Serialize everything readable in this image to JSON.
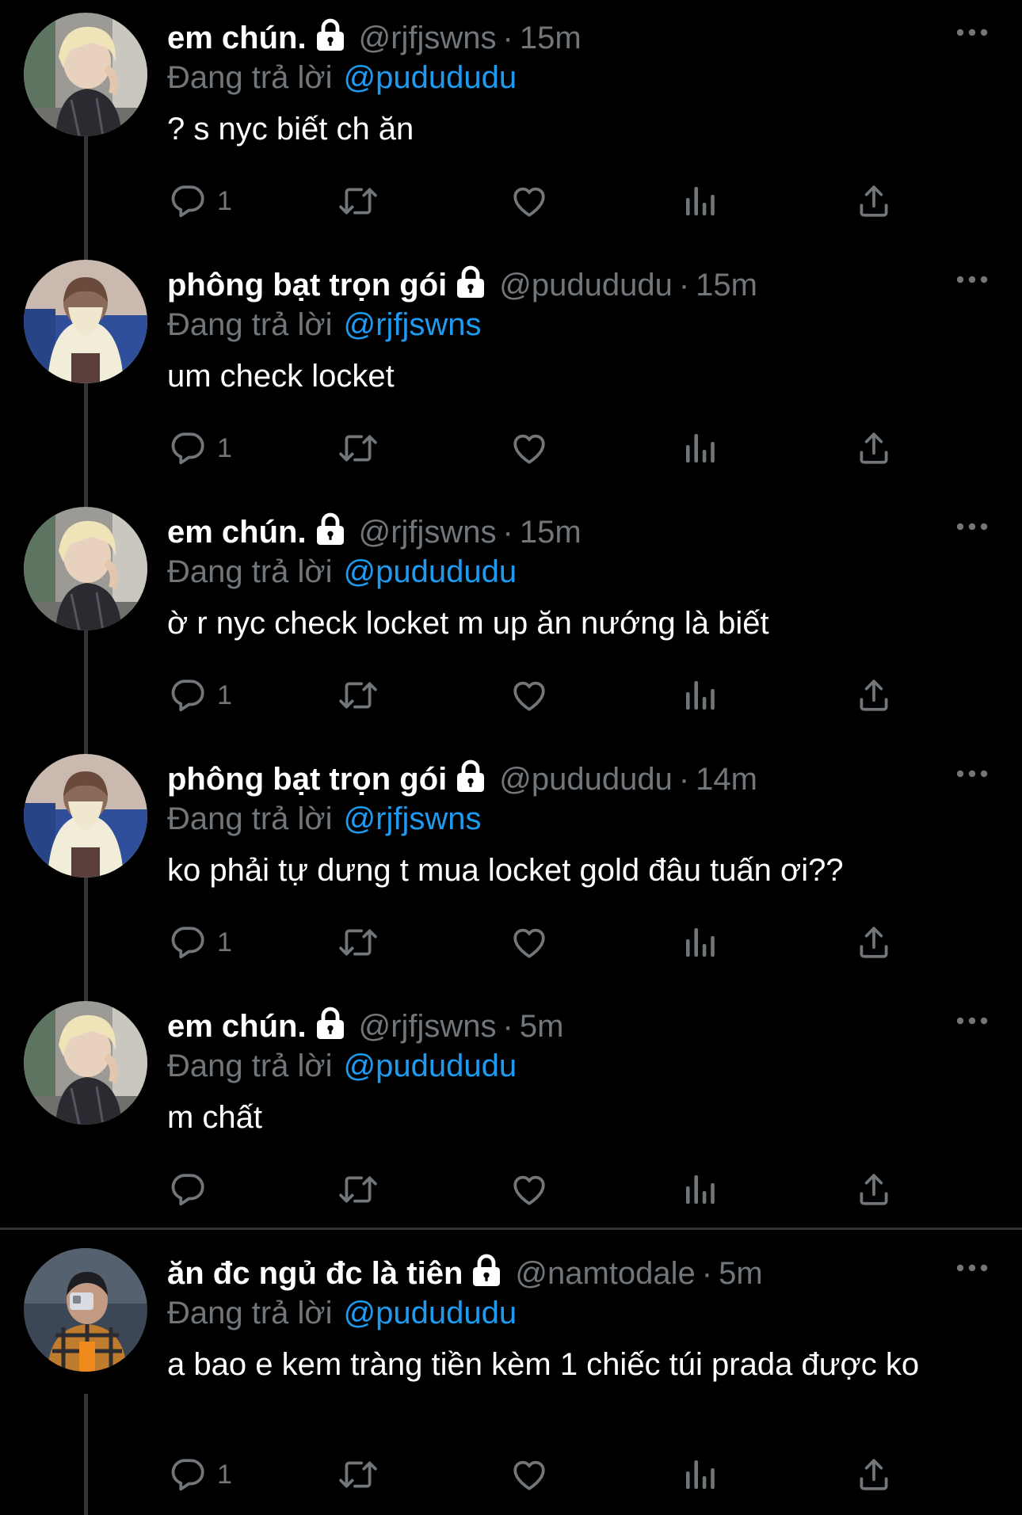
{
  "colors": {
    "background": "#000000",
    "text_primary": "#ffffff",
    "text_secondary": "#71767b",
    "link": "#1d9bf0",
    "thread_line": "#333639",
    "divider": "#2f3336"
  },
  "icons": {
    "reply": "reply-icon",
    "retweet": "retweet-icon",
    "like": "like-icon",
    "views": "views-icon",
    "share": "share-icon",
    "more": "more-icon",
    "protected": "lock-icon"
  },
  "tweets": [
    {
      "display_name": "em chún.",
      "handle": "@rjfjswns",
      "separator": "·",
      "time": "15m",
      "reply_prefix": "Đang trả lời",
      "reply_to": "@pudududu",
      "text": "? s nyc biết ch ăn",
      "reply_count": "1"
    },
    {
      "display_name": "phông bạt trọn gói",
      "handle": "@pudududu",
      "separator": "·",
      "time": "15m",
      "reply_prefix": "Đang trả lời",
      "reply_to": "@rjfjswns",
      "text": "um check locket",
      "reply_count": "1"
    },
    {
      "display_name": "em chún.",
      "handle": "@rjfjswns",
      "separator": "·",
      "time": "15m",
      "reply_prefix": "Đang trả lời",
      "reply_to": "@pudududu",
      "text": "ờ r nyc check locket m up ăn nướng là biết",
      "reply_count": "1"
    },
    {
      "display_name": "phông bạt trọn gói",
      "handle": "@pudududu",
      "separator": "·",
      "time": "14m",
      "reply_prefix": "Đang trả lời",
      "reply_to": "@rjfjswns",
      "text": "ko phải tự dưng t mua locket gold đâu tuấn ơi??",
      "reply_count": "1"
    },
    {
      "display_name": "em chún.",
      "handle": "@rjfjswns",
      "separator": "·",
      "time": "5m",
      "reply_prefix": "Đang trả lời",
      "reply_to": "@pudududu",
      "text": "m chất",
      "reply_count": ""
    },
    {
      "display_name": "ăn đc ngủ đc là tiên",
      "handle": "@namtodale",
      "separator": "·",
      "time": "5m",
      "reply_prefix": "Đang trả lời",
      "reply_to": "@pudududu",
      "text": "a bao e kem tràng tiền kèm 1 chiếc túi prada được ko",
      "reply_count": "1"
    }
  ]
}
